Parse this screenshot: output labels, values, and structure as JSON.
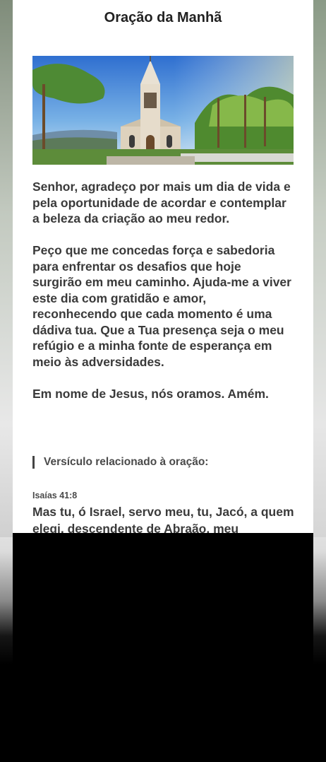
{
  "page": {
    "title": "Oração da Manhã"
  },
  "hero_image": {
    "icon": "chapel-landscape-image",
    "colors": {
      "sky": "#3d86d8",
      "trees": "#5f9a3a",
      "chapel": "#e8dcc8"
    }
  },
  "prayer": {
    "paragraphs": [
      "Senhor, agradeço por mais um dia de vida e pela oportunidade de acordar e contemplar a beleza da criação ao meu redor.",
      "Peço que me concedas força e sabedoria para enfrentar os desafios que hoje surgirão em meu caminho. Ajuda-me a viver este dia com gratidão e amor, reconhecendo que cada momento é uma dádiva tua. Que a Tua presença seja o meu refúgio e a minha fonte de esperança em meio às adversidades.",
      "Em nome de Jesus, nós oramos. Amém."
    ]
  },
  "verse": {
    "section_title": "Versículo relacionado à oração:",
    "reference": "Isaías 41:8",
    "text": "Mas tu, ó Israel, servo meu, tu, Jacó, a quem elegi, descendente de Abraão, meu"
  }
}
